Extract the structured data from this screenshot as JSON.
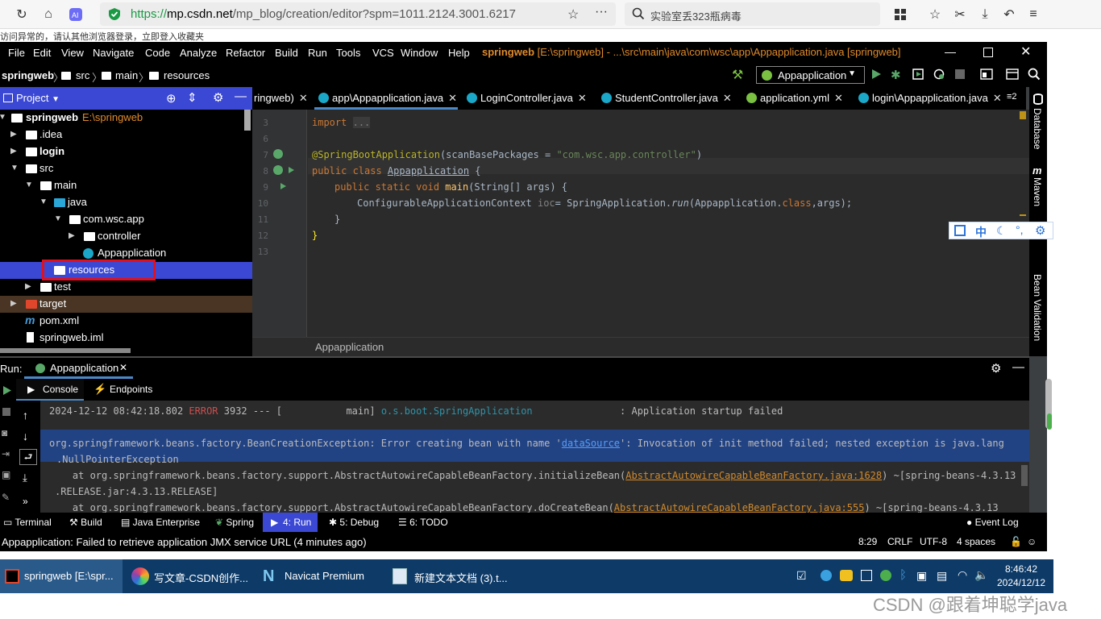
{
  "browser": {
    "url_scheme": "https://",
    "url_host": "mp.csdn.net",
    "url_path": "/mp_blog/creation/editor?spm=1011.2124.3001.6217",
    "search_text": "实验室丢323瓶病毒",
    "notice_strip": "访问异常的，请认其他浏览器登录，立即登入收藏夹"
  },
  "menu": [
    "File",
    "Edit",
    "View",
    "Navigate",
    "Code",
    "Analyze",
    "Refactor",
    "Build",
    "Run",
    "Tools",
    "VCS",
    "Window",
    "Help"
  ],
  "window_title_project": "springweb",
  "window_title_rest": "[E:\\springweb] - ...\\src\\main\\java\\com\\wsc\\app\\Appapplication.java [springweb]",
  "breadcrumb": [
    "springweb",
    "src",
    "main",
    "resources"
  ],
  "run_config": "Appapplication",
  "project_panel": {
    "title": "Project",
    "tree": [
      {
        "label": "springweb",
        "extra": "E:\\springweb"
      },
      {
        "label": ".idea"
      },
      {
        "label": "login"
      },
      {
        "label": "src"
      },
      {
        "label": "main"
      },
      {
        "label": "java"
      },
      {
        "label": "com.wsc.app"
      },
      {
        "label": "controller"
      },
      {
        "label": "Appapplication"
      },
      {
        "label": "resources"
      },
      {
        "label": "test"
      },
      {
        "label": "target"
      },
      {
        "label": "pom.xml"
      },
      {
        "label": "springweb.iml"
      }
    ]
  },
  "tabs": [
    "ringweb)",
    "app\\Appapplication.java",
    "LoginController.java",
    "StudentController.java",
    "application.yml",
    "login\\Appapplication.java",
    "≡2"
  ],
  "editor": {
    "line_numbers": [
      "3",
      "6",
      "7",
      "8",
      "9",
      "10",
      "11",
      "12",
      "13"
    ],
    "import_kw": "import",
    "import_fold": "...",
    "annotation": "@SpringBootApplication",
    "annotation_args_1": "(scanBasePackages = ",
    "annotation_str": "\"com.wsc.app.controller\"",
    "annotation_args_2": ")",
    "class_kw": "public class ",
    "class_name": "Appapplication",
    "class_brace": " {",
    "method_kw": "public static void ",
    "method_name": "main",
    "method_args": "(String[] args) {",
    "body_1": "ConfigurableApplicationContext ",
    "body_ioc": "ioc",
    "body_2": "= SpringApplication.",
    "body_run": "run",
    "body_3": "(Appapplication.",
    "body_class": "class",
    "body_4": ",args);",
    "close_method": "}",
    "close_class": "}",
    "crumb": "Appapplication"
  },
  "right_stripe": [
    "Database",
    "Maven",
    "Bean Validation"
  ],
  "run_panel": {
    "label": "Run:",
    "tab": "Appapplication",
    "subtabs": [
      "Console",
      "Endpoints"
    ],
    "log": {
      "line1_time": "2024-12-12 08:42:18.802 ",
      "line1_level": "ERROR",
      "line1_mid": " 3932 --- [           main] ",
      "line1_logger": "o.s.boot.SpringApplication",
      "line1_msg": "               : Application startup failed",
      "line2a": "org.springframework.beans.factory.BeanCreationException: Error creating bean with name '",
      "line2_link": "dataSource",
      "line2b": "': Invocation of init method failed; nested exception is java.lang",
      "line3": ".NullPointerException",
      "line4a": "    at org.springframework.beans.factory.support.AbstractAutowireCapableBeanFactory.initializeBean(",
      "line4_link": "AbstractAutowireCapableBeanFactory.java:1628",
      "line4b": ") ~[spring-beans-4.3.13",
      "line5": ".RELEASE.jar:4.3.13.RELEASE]",
      "line6a": "    at org.springframework.beans.factory.support.AbstractAutowireCapableBeanFactory.doCreateBean(",
      "line6_link": "AbstractAutowireCapableBeanFactory.java:555",
      "line6b": ") ~[spring-beans-4.3.13"
    }
  },
  "bottom_tools": [
    "Terminal",
    "Build",
    "Java Enterprise",
    "Spring",
    "4: Run",
    "5: Debug",
    "6: TODO",
    "Event Log"
  ],
  "status": {
    "message": "Appapplication: Failed to retrieve application JMX service URL (4 minutes ago)",
    "position": "8:29",
    "line_sep": "CRLF",
    "encoding": "UTF-8",
    "indent": "4 spaces"
  },
  "taskbar": {
    "items": [
      "springweb [E:\\spr...",
      "写文章-CSDN创作...",
      "Navicat Premium",
      "新建文本文档 (3).t..."
    ],
    "time": "8:46:42",
    "date": "2024/12/12"
  },
  "ime_toolbar": [
    "中"
  ],
  "watermark": "CSDN @跟着坤聪学java",
  "colors": {
    "selection_blue": "#3b48d4",
    "highlight_red": "#e0101e",
    "accent_orange": "#e08a2b"
  }
}
